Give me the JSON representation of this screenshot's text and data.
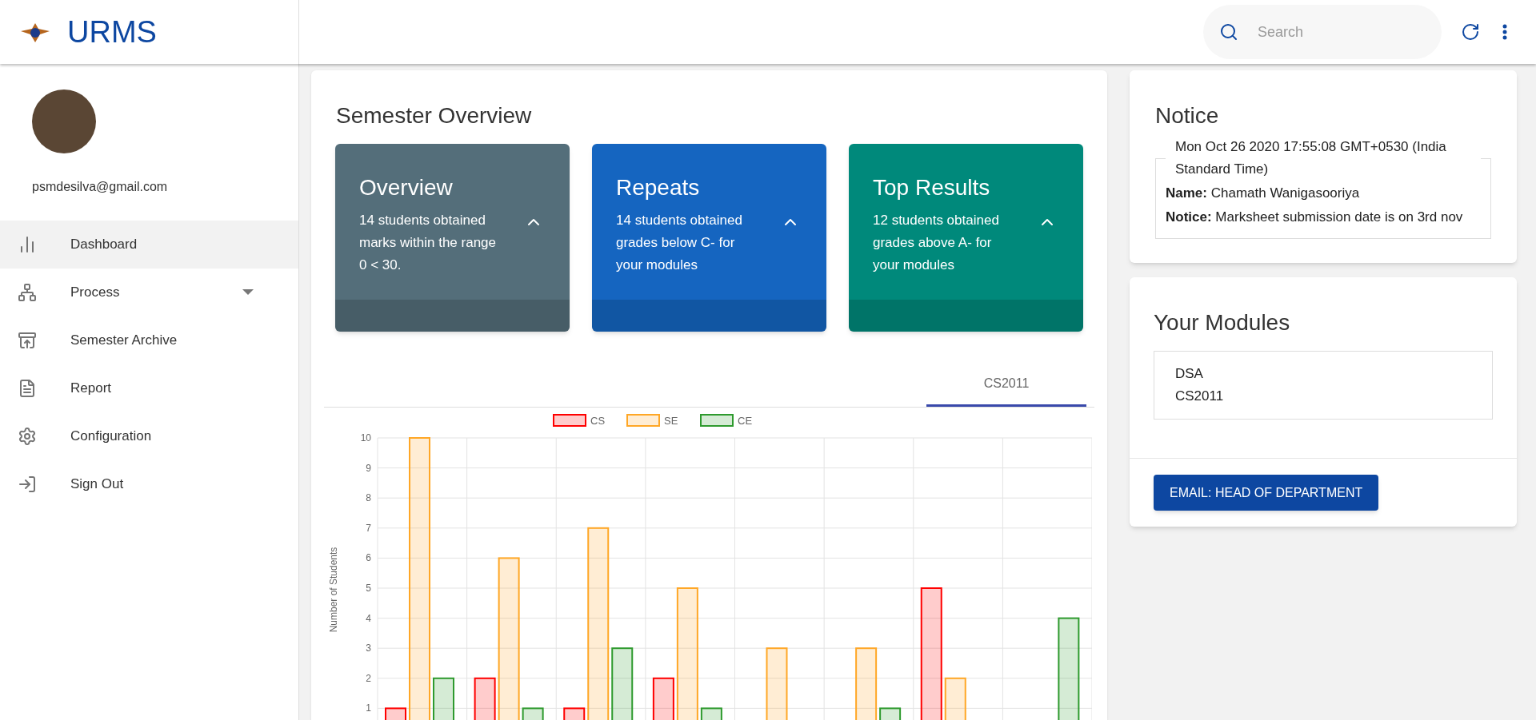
{
  "header": {
    "logo_text": "URMS",
    "search": {
      "placeholder": "Search"
    }
  },
  "sidebar": {
    "email": "psmdesilva@gmail.com",
    "items": [
      {
        "label": "Dashboard",
        "kind": "chart",
        "selected": true,
        "expandable": false
      },
      {
        "label": "Process",
        "kind": "tree",
        "selected": false,
        "expandable": true
      },
      {
        "label": "Semester Archive",
        "kind": "archive",
        "selected": false,
        "expandable": false
      },
      {
        "label": "Report",
        "kind": "file",
        "selected": false,
        "expandable": false
      },
      {
        "label": "Configuration",
        "kind": "gear",
        "selected": false,
        "expandable": false
      },
      {
        "label": "Sign Out",
        "kind": "signout",
        "selected": false,
        "expandable": false
      }
    ]
  },
  "overview": {
    "title": "Semester Overview",
    "cards": [
      {
        "title": "Overview",
        "text": "14 students obtained marks within the range 0 < 30.",
        "color": "#546e7a"
      },
      {
        "title": "Repeats",
        "text": "14 students obtained grades below C- for your modules",
        "color": "#1565c0"
      },
      {
        "title": "Top Results",
        "text": "12 students obtained grades above A- for your modules",
        "color": "#00897b"
      }
    ],
    "tabs": [
      {
        "label": "CS2011",
        "selected": true
      }
    ],
    "chart_data": {
      "type": "bar",
      "grid": true,
      "legend": true,
      "ylabel": "Number of Students",
      "ylim": [
        0,
        10
      ],
      "yticks": [
        1,
        2,
        3,
        4,
        5,
        6,
        7,
        8,
        9,
        10
      ],
      "series": [
        {
          "name": "CS",
          "color": "#ff0000",
          "values": [
            1,
            2,
            1,
            2,
            0,
            0,
            5,
            0
          ]
        },
        {
          "name": "SE",
          "color": "#ffa726",
          "values": [
            10,
            6,
            7,
            5,
            3,
            3,
            2,
            0
          ]
        },
        {
          "name": "CE",
          "color": "#2e9a2e",
          "values": [
            2,
            1,
            3,
            1,
            0,
            1,
            0,
            4
          ]
        }
      ]
    }
  },
  "notice": {
    "title": "Notice",
    "date": "Mon Oct 26 2020 17:55:08 GMT+0530 (India Standard Time)",
    "entries": [
      {
        "label": "Name:",
        "text": "Chamath Wanigasooriya"
      },
      {
        "label": "Notice:",
        "text": "Marksheet submission date is on 3rd nov"
      }
    ]
  },
  "modules": {
    "title": "Your Modules",
    "items": [
      "DSA",
      "CS2011"
    ],
    "button": "EMAIL: HEAD OF DEPARTMENT"
  }
}
